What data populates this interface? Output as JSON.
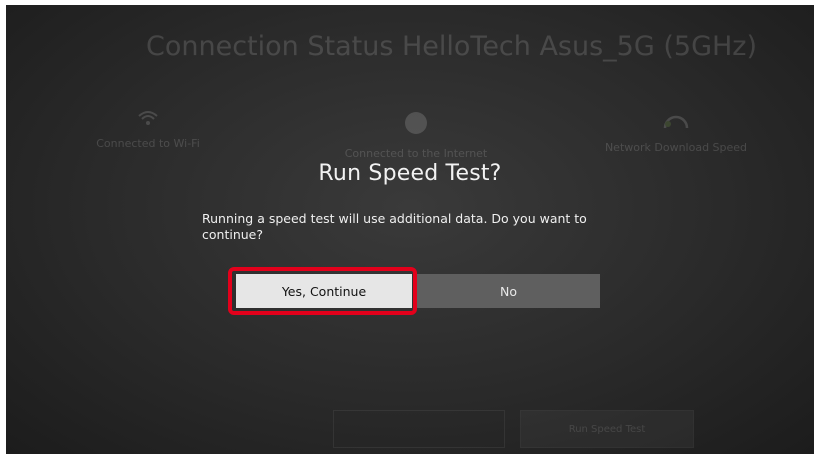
{
  "background": {
    "title": "Connection Status HelloTech Asus_5G (5GHz)",
    "status_items": [
      {
        "label": "Connected to Wi-Fi",
        "icon": "wifi-icon"
      },
      {
        "label": "Connected to the Internet",
        "icon": "globe-icon"
      },
      {
        "label": "Network Download Speed",
        "icon": "speedometer-icon"
      }
    ],
    "run_speed_test_button": "Run Speed Test"
  },
  "dialog": {
    "title": "Run Speed Test?",
    "message": "Running a speed test will use additional data. Do you want to continue?",
    "confirm_label": "Yes, Continue",
    "cancel_label": "No",
    "highlight_color": "#e3001b"
  }
}
